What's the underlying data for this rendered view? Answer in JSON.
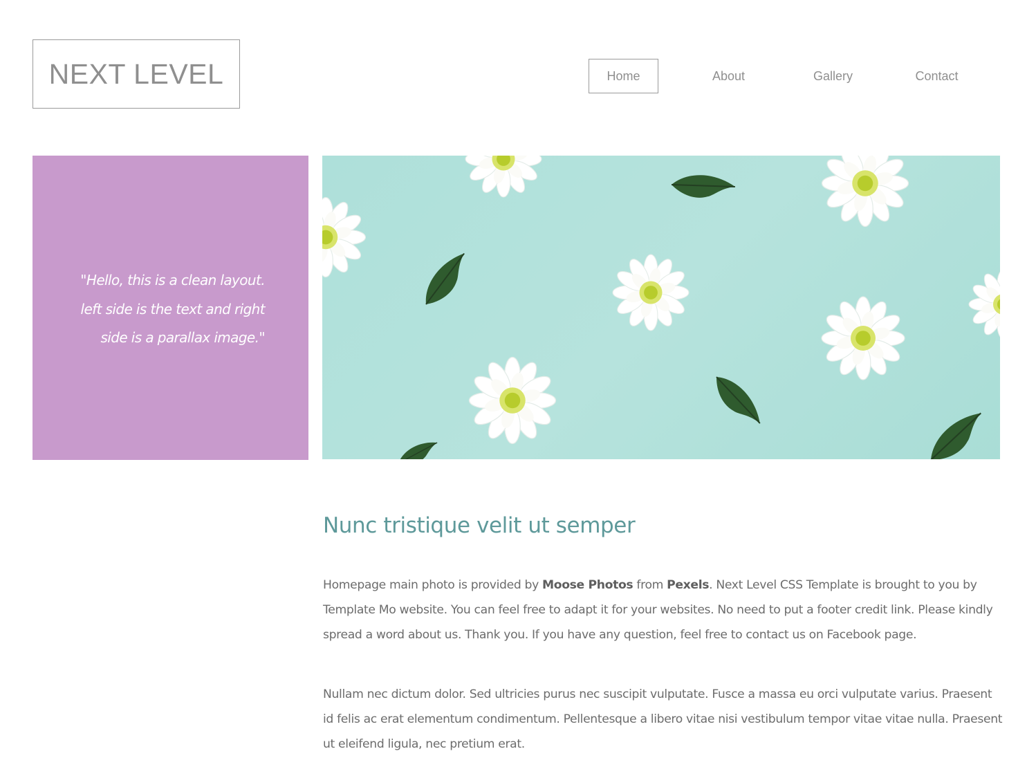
{
  "brand": {
    "logo_text": "NEXT LEVEL"
  },
  "nav": {
    "items": [
      {
        "label": "Home",
        "active": true
      },
      {
        "label": "About",
        "active": false
      },
      {
        "label": "Gallery",
        "active": false
      },
      {
        "label": "Contact",
        "active": false
      }
    ]
  },
  "hero": {
    "quote_lines": [
      "\"Hello, this is a clean layout.",
      "left side is the text and right",
      "side is a parallax image.\""
    ],
    "image_icon": "flowers-photo",
    "colors": {
      "quote_bg": "#c89acc",
      "image_bg": "#b0e0da"
    }
  },
  "content": {
    "heading": "Nunc tristique velit ut semper",
    "para1": {
      "t1": "Homepage main photo is provided by ",
      "b1": "Moose Photos",
      "t2": " from ",
      "b2": "Pexels",
      "t3": ". Next Level CSS Template is brought to you by Template Mo website. You can feel free to adapt it for your websites. No need to put a footer credit link. Please kindly spread a word about us. Thank you. If you have any question, feel free to contact us on Facebook page."
    },
    "para2": "Nullam nec dictum dolor. Sed ultricies purus nec suscipit vulputate. Fusce a massa eu orci vulputate varius. Praesent id felis ac erat elementum condimentum. Pellentesque a libero vitae nisi vestibulum tempor vitae vitae nulla. Praesent ut eleifend ligula, nec pretium erat."
  },
  "colors": {
    "heading": "#5e999a",
    "text": "#6c6c6c",
    "nav_text": "#8f8f8f"
  }
}
